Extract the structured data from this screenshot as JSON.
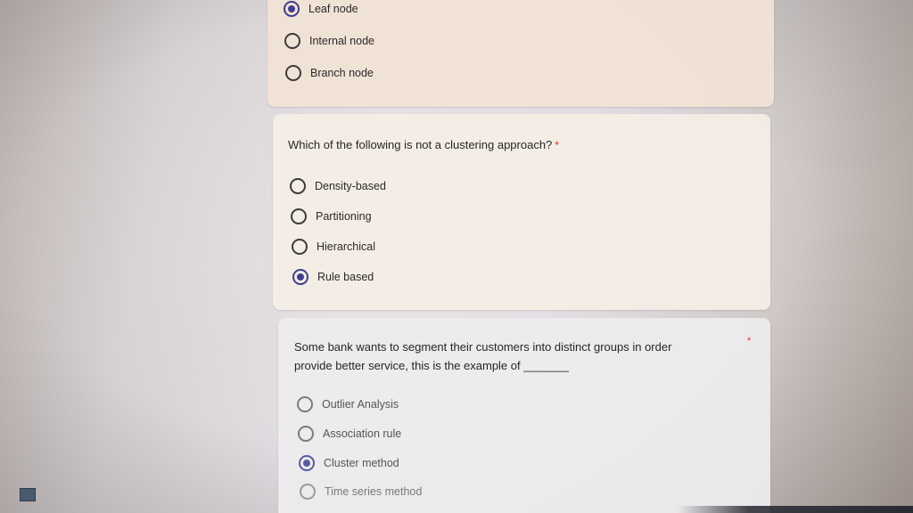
{
  "questions": [
    {
      "text": "",
      "required": false,
      "options": [
        {
          "label": "Leaf node",
          "checked": true
        },
        {
          "label": "Internal node",
          "checked": false
        },
        {
          "label": "Branch node",
          "checked": false
        }
      ]
    },
    {
      "text": "Which of the following is not a clustering approach?",
      "required_mark": "*",
      "options": [
        {
          "label": "Density-based",
          "checked": false
        },
        {
          "label": "Partitioning",
          "checked": false
        },
        {
          "label": "Hierarchical",
          "checked": false
        },
        {
          "label": "Rule based",
          "checked": true
        }
      ]
    },
    {
      "text_line1": "Some bank wants to segment their customers into distinct groups in order",
      "text_line2": "provide better service, this is the example of _______",
      "required_mark": "*",
      "options": [
        {
          "label": "Outlier Analysis",
          "checked": false
        },
        {
          "label": "Association rule",
          "checked": false
        },
        {
          "label": "Cluster method",
          "checked": true
        },
        {
          "label": "Time series method",
          "checked": false
        }
      ]
    }
  ],
  "colors": {
    "accent": "#3d3f8f",
    "required": "#d93025"
  },
  "icons": {
    "taskbar": "app-icon"
  }
}
